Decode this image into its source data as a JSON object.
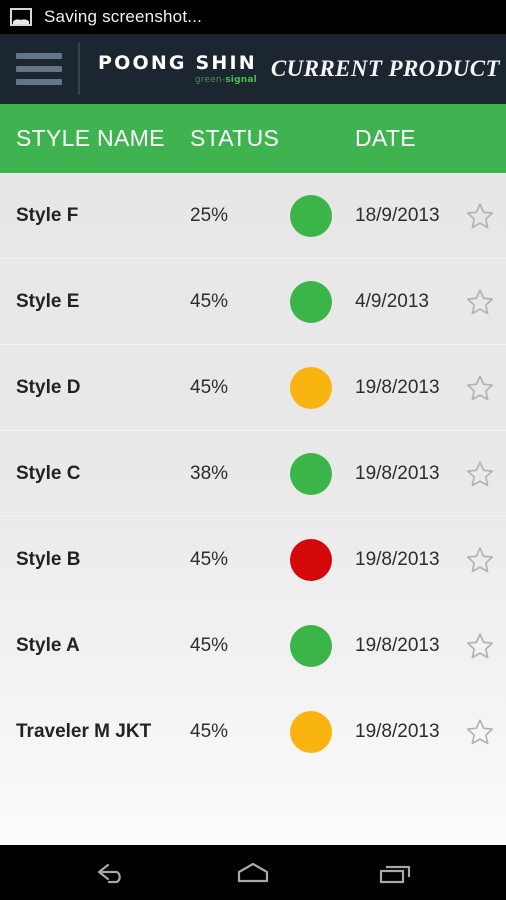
{
  "statusbar": {
    "icon": "image-icon",
    "text": "Saving screenshot..."
  },
  "appbar": {
    "menu_icon": "hamburger-menu-icon",
    "logo_main": "POONG SHIN",
    "logo_sub_part1": "green-",
    "logo_sub_part2": "signal",
    "title": "CURRENT PRODUCT",
    "bg_color": "#1c2630"
  },
  "table": {
    "headers": {
      "style_name": "STYLE NAME",
      "status": "STATUS",
      "date": "DATE"
    },
    "header_bg": "#3fb34f",
    "status_colors": {
      "green": "#3bb54a",
      "amber": "#f9b40f",
      "red": "#d40808"
    },
    "rows": [
      {
        "name": "Style F",
        "percent": "25%",
        "status_color": "#3bb54a",
        "status": "green",
        "date": "18/9/2013",
        "favorite": false
      },
      {
        "name": "Style E",
        "percent": "45%",
        "status_color": "#3bb54a",
        "status": "green",
        "date": "4/9/2013",
        "favorite": false
      },
      {
        "name": "Style D",
        "percent": "45%",
        "status_color": "#f9b40f",
        "status": "amber",
        "date": "19/8/2013",
        "favorite": false
      },
      {
        "name": "Style C",
        "percent": "38%",
        "status_color": "#3bb54a",
        "status": "green",
        "date": "19/8/2013",
        "favorite": false
      },
      {
        "name": "Style B",
        "percent": "45%",
        "status_color": "#d40808",
        "status": "red",
        "date": "19/8/2013",
        "favorite": false
      },
      {
        "name": "Style A",
        "percent": "45%",
        "status_color": "#3bb54a",
        "status": "green",
        "date": "19/8/2013",
        "favorite": false
      },
      {
        "name": "Traveler M JKT",
        "percent": "45%",
        "status_color": "#f9b40f",
        "status": "amber",
        "date": "19/8/2013",
        "favorite": false
      }
    ]
  },
  "navbar": {
    "back": "back-icon",
    "home": "home-icon",
    "recents": "recent-apps-icon"
  }
}
